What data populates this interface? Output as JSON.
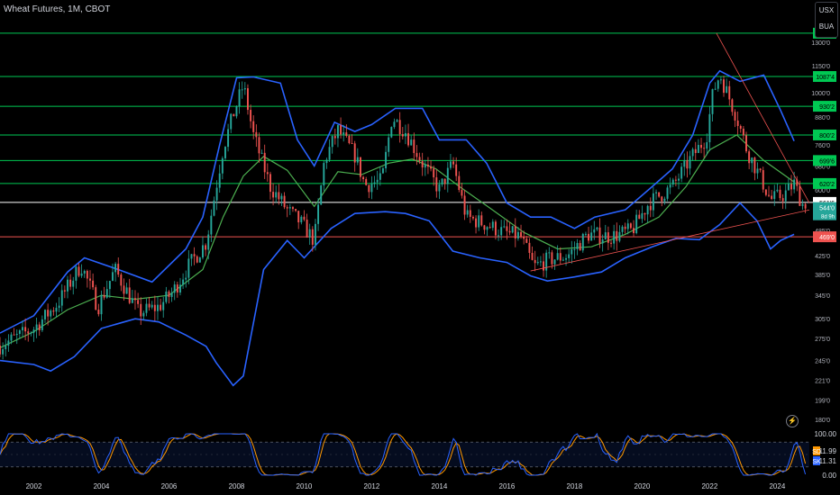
{
  "header": {
    "title": "Wheat Futures, 1M, CBOT",
    "currency": "USX",
    "unit": "BUA"
  },
  "icons": {
    "lightning": "lightning-icon"
  },
  "colors": {
    "up": "#26a69a",
    "down": "#ef5350",
    "band": "#2962ff",
    "mid": "#4caf50",
    "stochK": "#2962ff",
    "stochD": "#ff9800",
    "hline": "#00c853",
    "support": "#ef5350",
    "current": "#ffffff"
  },
  "chart_data": {
    "type": "candlestick",
    "symbol": "Wheat Futures",
    "interval": "1M",
    "exchange": "CBOT",
    "xlim": [
      2001.0,
      2024.95
    ],
    "ylim": [
      170.0,
      1410.0
    ],
    "log_scale": true,
    "grid": false,
    "x_ticks": [
      "2002",
      "2004",
      "2006",
      "2008",
      "2010",
      "2012",
      "2014",
      "2016",
      "2018",
      "2020",
      "2022",
      "2024"
    ],
    "y_ticks": [
      "1300'0",
      "1150'0",
      "1000'0",
      "880'0",
      "760'0",
      "680'0",
      "600'0",
      "485'0",
      "425'0",
      "385'0",
      "345'0",
      "305'0",
      "275'0",
      "245'0",
      "221'0",
      "199'0",
      "180'0"
    ],
    "horizontal_levels": [
      {
        "label": "1365'0",
        "value": 1365,
        "color": "#00c853"
      },
      {
        "label": "1087'4",
        "value": 1087.5,
        "color": "#00c853"
      },
      {
        "label": "930'2",
        "value": 930.25,
        "color": "#00c853"
      },
      {
        "label": "800'2",
        "value": 800.25,
        "color": "#00c853"
      },
      {
        "label": "699'6",
        "value": 699.75,
        "color": "#00c853"
      },
      {
        "label": "620'2",
        "value": 620.25,
        "color": "#00c853"
      },
      {
        "label": "561'6",
        "value": 561.75,
        "color": "#ffffff"
      },
      {
        "label": "469'0",
        "value": 469,
        "color": "#ef5350"
      }
    ],
    "price_tag": {
      "value": "544'0",
      "countdown": "8d 9h",
      "price": 544
    },
    "trendlines": [
      {
        "from": [
          2022.2,
          1365
        ],
        "to": [
          2024.95,
          560
        ],
        "color": "#ef5350"
      },
      {
        "from": [
          2016.7,
          392
        ],
        "to": [
          2024.95,
          540
        ],
        "color": "#ef5350"
      }
    ],
    "anchors": [
      [
        2001.0,
        265
      ],
      [
        2002.0,
        290
      ],
      [
        2002.7,
        330
      ],
      [
        2003.4,
        405
      ],
      [
        2003.9,
        325
      ],
      [
        2004.4,
        395
      ],
      [
        2005.1,
        315
      ],
      [
        2005.7,
        325
      ],
      [
        2006.1,
        350
      ],
      [
        2006.6,
        405
      ],
      [
        2007.1,
        455
      ],
      [
        2007.6,
        745
      ],
      [
        2007.9,
        890
      ],
      [
        2008.2,
        1040
      ],
      [
        2008.5,
        800
      ],
      [
        2009.0,
        610
      ],
      [
        2009.5,
        540
      ],
      [
        2009.9,
        505
      ],
      [
        2010.3,
        460
      ],
      [
        2010.6,
        700
      ],
      [
        2011.0,
        820
      ],
      [
        2011.5,
        720
      ],
      [
        2011.8,
        615
      ],
      [
        2012.3,
        630
      ],
      [
        2012.6,
        880
      ],
      [
        2013.0,
        815
      ],
      [
        2013.5,
        690
      ],
      [
        2014.0,
        600
      ],
      [
        2014.4,
        690
      ],
      [
        2014.8,
        520
      ],
      [
        2015.4,
        500
      ],
      [
        2015.9,
        480
      ],
      [
        2016.4,
        470
      ],
      [
        2016.8,
        400
      ],
      [
        2017.2,
        415
      ],
      [
        2017.8,
        425
      ],
      [
        2018.4,
        475
      ],
      [
        2019.1,
        470
      ],
      [
        2019.7,
        485
      ],
      [
        2020.2,
        560
      ],
      [
        2020.9,
        610
      ],
      [
        2021.4,
        700
      ],
      [
        2021.9,
        790
      ],
      [
        2022.1,
        1000
      ],
      [
        2022.3,
        1100
      ],
      [
        2022.8,
        880
      ],
      [
        2023.1,
        740
      ],
      [
        2023.5,
        640
      ],
      [
        2023.8,
        570
      ],
      [
        2024.2,
        585
      ],
      [
        2024.5,
        620
      ],
      [
        2024.8,
        544
      ]
    ],
    "bollinger": {
      "upper": [
        [
          2001.0,
          283
        ],
        [
          2002.0,
          310
        ],
        [
          2003.0,
          390
        ],
        [
          2003.5,
          420
        ],
        [
          2004.5,
          395
        ],
        [
          2005.5,
          370
        ],
        [
          2006.5,
          440
        ],
        [
          2007.0,
          520
        ],
        [
          2007.5,
          760
        ],
        [
          2008.0,
          1080
        ],
        [
          2008.5,
          1085
        ],
        [
          2009.3,
          1050
        ],
        [
          2009.8,
          780
        ],
        [
          2010.3,
          680
        ],
        [
          2010.9,
          855
        ],
        [
          2011.5,
          815
        ],
        [
          2012.0,
          845
        ],
        [
          2012.7,
          920
        ],
        [
          2013.5,
          920
        ],
        [
          2014.0,
          780
        ],
        [
          2014.8,
          780
        ],
        [
          2015.4,
          690
        ],
        [
          2016.0,
          560
        ],
        [
          2016.7,
          520
        ],
        [
          2017.3,
          520
        ],
        [
          2018.0,
          490
        ],
        [
          2018.6,
          520
        ],
        [
          2019.5,
          540
        ],
        [
          2020.3,
          610
        ],
        [
          2020.9,
          670
        ],
        [
          2021.5,
          800
        ],
        [
          2022.0,
          1050
        ],
        [
          2022.3,
          1120
        ],
        [
          2022.9,
          1060
        ],
        [
          2023.6,
          1095
        ],
        [
          2024.1,
          910
        ],
        [
          2024.5,
          775
        ]
      ],
      "middle": [
        [
          2001.0,
          262
        ],
        [
          2002.0,
          285
        ],
        [
          2003.0,
          320
        ],
        [
          2004.0,
          345
        ],
        [
          2005.0,
          338
        ],
        [
          2006.0,
          345
        ],
        [
          2007.0,
          395
        ],
        [
          2007.6,
          520
        ],
        [
          2008.2,
          645
        ],
        [
          2008.8,
          715
        ],
        [
          2009.5,
          665
        ],
        [
          2010.3,
          550
        ],
        [
          2011.0,
          660
        ],
        [
          2011.7,
          650
        ],
        [
          2012.5,
          690
        ],
        [
          2013.2,
          705
        ],
        [
          2013.9,
          670
        ],
        [
          2014.6,
          610
        ],
        [
          2015.5,
          545
        ],
        [
          2016.5,
          480
        ],
        [
          2017.5,
          440
        ],
        [
          2018.5,
          445
        ],
        [
          2019.5,
          475
        ],
        [
          2020.5,
          520
        ],
        [
          2021.3,
          610
        ],
        [
          2022.0,
          740
        ],
        [
          2022.8,
          800
        ],
        [
          2023.6,
          700
        ],
        [
          2024.5,
          625
        ]
      ],
      "lower": [
        [
          2001.0,
          245
        ],
        [
          2002.0,
          240
        ],
        [
          2002.5,
          232
        ],
        [
          2003.2,
          250
        ],
        [
          2004.0,
          290
        ],
        [
          2005.0,
          305
        ],
        [
          2005.7,
          300
        ],
        [
          2006.5,
          280
        ],
        [
          2007.1,
          264
        ],
        [
          2007.4,
          242
        ],
        [
          2007.9,
          215
        ],
        [
          2008.2,
          226
        ],
        [
          2008.8,
          395
        ],
        [
          2009.5,
          460
        ],
        [
          2010.0,
          420
        ],
        [
          2010.8,
          490
        ],
        [
          2011.5,
          530
        ],
        [
          2012.4,
          535
        ],
        [
          2013.0,
          530
        ],
        [
          2013.7,
          510
        ],
        [
          2014.4,
          435
        ],
        [
          2015.2,
          420
        ],
        [
          2016.0,
          410
        ],
        [
          2016.7,
          382
        ],
        [
          2017.2,
          372
        ],
        [
          2018.0,
          380
        ],
        [
          2018.8,
          390
        ],
        [
          2019.5,
          420
        ],
        [
          2020.3,
          445
        ],
        [
          2021.0,
          465
        ],
        [
          2021.7,
          462
        ],
        [
          2022.3,
          500
        ],
        [
          2022.9,
          560
        ],
        [
          2023.4,
          510
        ],
        [
          2023.8,
          440
        ],
        [
          2024.1,
          460
        ],
        [
          2024.5,
          475
        ]
      ]
    },
    "oscillator": {
      "ylim": [
        0,
        100
      ],
      "levels": [
        20,
        80
      ],
      "ticks": [
        "100.00",
        "0.00"
      ],
      "readout": [
        {
          "name": "SD",
          "value": "11.99",
          "color": "#ff9800"
        },
        {
          "name": "SK",
          "value": "11.31",
          "color": "#2962ff"
        }
      ]
    }
  }
}
